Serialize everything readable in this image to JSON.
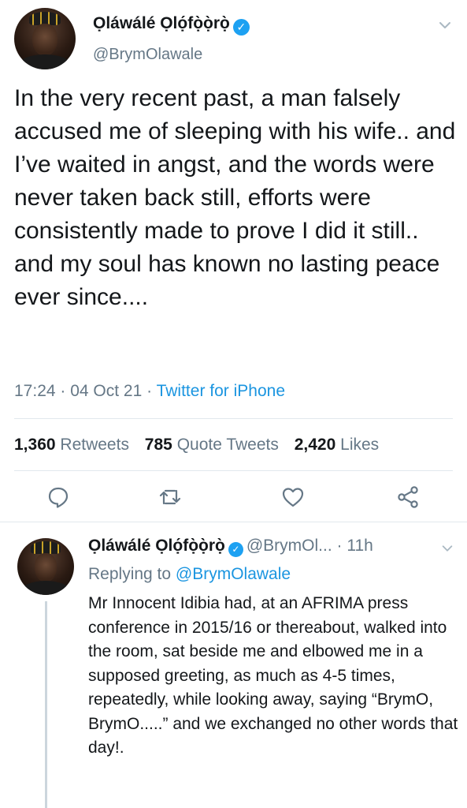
{
  "main_tweet": {
    "display_name": "Ọláwálé Ọlọ́fọ̀ọ̀rọ̀",
    "handle": "@BrymOlawale",
    "text": "In the very recent past, a man falsely accused me of sleeping with his wife.. and I’ve waited in angst, and the words were never taken back still, efforts were consistently made to prove I did it still.. and my soul has known no lasting peace ever since....",
    "time": "17:24",
    "date": "04 Oct 21",
    "source": "Twitter for iPhone",
    "stats": {
      "retweets_count": "1,360",
      "retweets_label": "Retweets",
      "quotes_count": "785",
      "quotes_label": "Quote Tweets",
      "likes_count": "2,420",
      "likes_label": "Likes"
    },
    "actions": {
      "reply_icon": "speech-bubble-icon",
      "retweet_icon": "retweet-icon",
      "like_icon": "heart-icon",
      "share_icon": "share-icon"
    }
  },
  "reply_tweet": {
    "display_name": "Ọláwálé Ọlọ́fọ̀ọ̀rọ̀",
    "handle": "@BrymOl...",
    "age": "11h",
    "replying_prefix": "Replying to",
    "replying_to": "@BrymOlawale",
    "text": "Mr Innocent Idibia had, at an AFRIMA press conference in 2015/16 or thereabout, walked into the room, sat beside me and elbowed me in a supposed greeting, as much as 4-5 times, repeatedly, while looking away, saying “BrymO, BrymO.....” and we exchanged no other words that day!."
  },
  "colors": {
    "accent": "#1da1f2",
    "link": "#1b95e0",
    "secondary_text": "#657786",
    "primary_text": "#14171a",
    "divider": "#e1e8ed"
  }
}
